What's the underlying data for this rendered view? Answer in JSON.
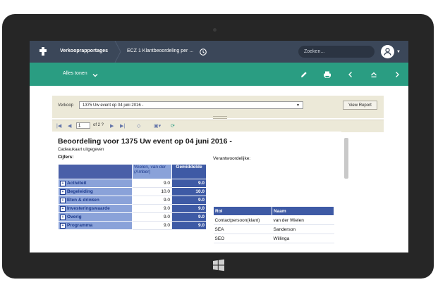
{
  "header": {
    "app_title": "Verkooprapportages",
    "breadcrumb": "ECZ 1 Klantbeoordeling per ...",
    "search_placeholder": "Zoeken..."
  },
  "toolbar": {
    "show_all_label": "Alles tonen",
    "icons": [
      "pencil-icon",
      "print-icon",
      "chevron-left-icon",
      "eject-icon",
      "chevron-right-icon"
    ],
    "accent_color": "#2a9d82"
  },
  "params": {
    "label": "Verkoop",
    "selected_value": "1375 Uw event op 04 juni 2016 -",
    "view_report_label": "View Report"
  },
  "pager": {
    "current_page": "1",
    "of_label": "of 2 ?"
  },
  "report": {
    "title": "Beoordeling voor 1375 Uw event op 04 juni 2016 -",
    "subtitle": "Cadeaukaart uitgegeven",
    "cijfers_label": "Cijfers:",
    "verantwoordelijke_label": "Verantwoordelijke:",
    "columns": [
      "Wielen, van der (Amber)",
      "Gemiddelde"
    ],
    "rows": [
      {
        "label": "Activiteit",
        "value": "9.0",
        "avg": "9.0"
      },
      {
        "label": "Begeleiding",
        "value": "10.0",
        "avg": "10.0"
      },
      {
        "label": "Eten & drinken",
        "value": "9.0",
        "avg": "9.0"
      },
      {
        "label": "Investeringswaarde",
        "value": "9.0",
        "avg": "9.0"
      },
      {
        "label": "Overig",
        "value": "9.0",
        "avg": "9.0"
      },
      {
        "label": "Programma",
        "value": "9.0",
        "avg": "9.0"
      }
    ],
    "roles_headers": [
      "Rol",
      "Naam"
    ],
    "roles": [
      {
        "rol": "Contactpersoon(klant)",
        "naam": "van der Wielen"
      },
      {
        "rol": "SEA",
        "naam": "Sanderson"
      },
      {
        "rol": "SEO",
        "naam": "Willinga"
      }
    ]
  },
  "colors": {
    "topbar": "#3b4759",
    "header_blue": "#3e5aa5",
    "light_blue": "#8aa2d9"
  }
}
